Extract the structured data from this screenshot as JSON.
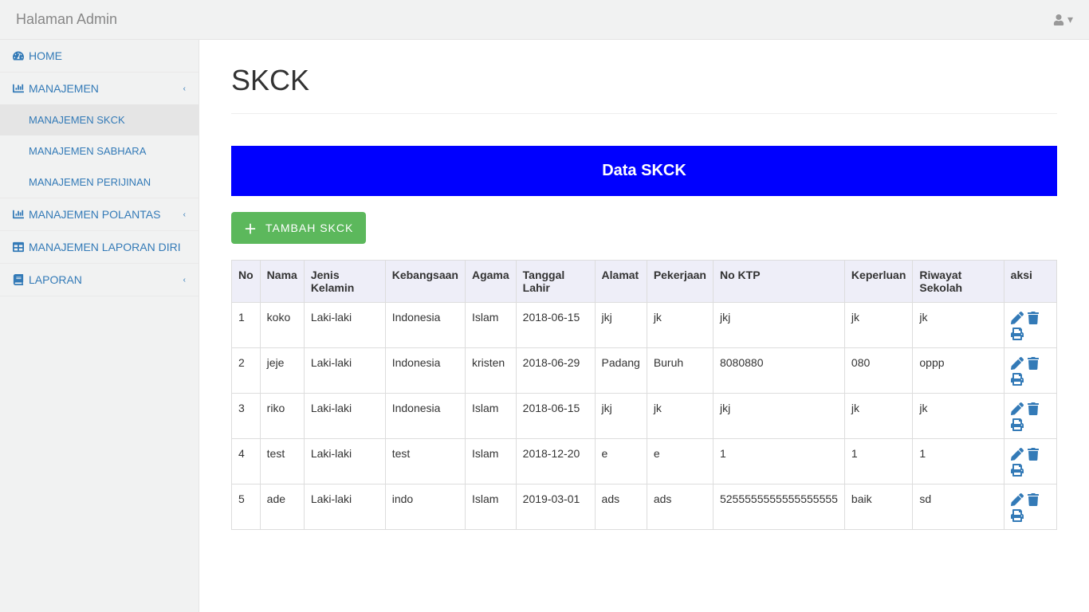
{
  "topbar": {
    "brand": "Halaman Admin"
  },
  "sidebar": {
    "home": "HOME",
    "manajemen": "MANAJEMEN",
    "manajemen_sub": {
      "skck": "MANAJEMEN SKCK",
      "sabhara": "MANAJEMEN SABHARA",
      "perijinan": "MANAJEMEN PERIJINAN"
    },
    "polantas": "MANAJEMEN POLANTAS",
    "laporan_diri": "MANAJEMEN LAPORAN DIRI",
    "laporan": "LAPORAN"
  },
  "page": {
    "title": "SKCK",
    "banner": "Data SKCK",
    "add_button": "TAMBAH   SKCK"
  },
  "table": {
    "headers": {
      "no": "No",
      "nama": "Nama",
      "jenis_kelamin": "Jenis Kelamin",
      "kebangsaan": "Kebangsaan",
      "agama": "Agama",
      "tanggal_lahir": "Tanggal Lahir",
      "alamat": "Alamat",
      "pekerjaan": "Pekerjaan",
      "no_ktp": "No KTP",
      "keperluan": "Keperluan",
      "riwayat_sekolah": "Riwayat Sekolah",
      "aksi": "aksi"
    },
    "rows": [
      {
        "no": "1",
        "nama": "koko",
        "jenis_kelamin": "Laki-laki",
        "kebangsaan": "Indonesia",
        "agama": "Islam",
        "tanggal_lahir": "2018-06-15",
        "alamat": "jkj",
        "pekerjaan": "jk",
        "no_ktp": "jkj",
        "keperluan": "jk",
        "riwayat_sekolah": "jk"
      },
      {
        "no": "2",
        "nama": "jeje",
        "jenis_kelamin": "Laki-laki",
        "kebangsaan": "Indonesia",
        "agama": "kristen",
        "tanggal_lahir": "2018-06-29",
        "alamat": "Padang",
        "pekerjaan": "Buruh",
        "no_ktp": "8080880",
        "keperluan": "080",
        "riwayat_sekolah": "oppp"
      },
      {
        "no": "3",
        "nama": "riko",
        "jenis_kelamin": "Laki-laki",
        "kebangsaan": "Indonesia",
        "agama": "Islam",
        "tanggal_lahir": "2018-06-15",
        "alamat": "jkj",
        "pekerjaan": "jk",
        "no_ktp": "jkj",
        "keperluan": "jk",
        "riwayat_sekolah": "jk"
      },
      {
        "no": "4",
        "nama": "test",
        "jenis_kelamin": "Laki-laki",
        "kebangsaan": "test",
        "agama": "Islam",
        "tanggal_lahir": "2018-12-20",
        "alamat": "e",
        "pekerjaan": "e",
        "no_ktp": "1",
        "keperluan": "1",
        "riwayat_sekolah": "1"
      },
      {
        "no": "5",
        "nama": "ade",
        "jenis_kelamin": "Laki-laki",
        "kebangsaan": "indo",
        "agama": "Islam",
        "tanggal_lahir": "2019-03-01",
        "alamat": "ads",
        "pekerjaan": "ads",
        "no_ktp": "5255555555555555555",
        "keperluan": "baik",
        "riwayat_sekolah": "sd"
      }
    ]
  }
}
